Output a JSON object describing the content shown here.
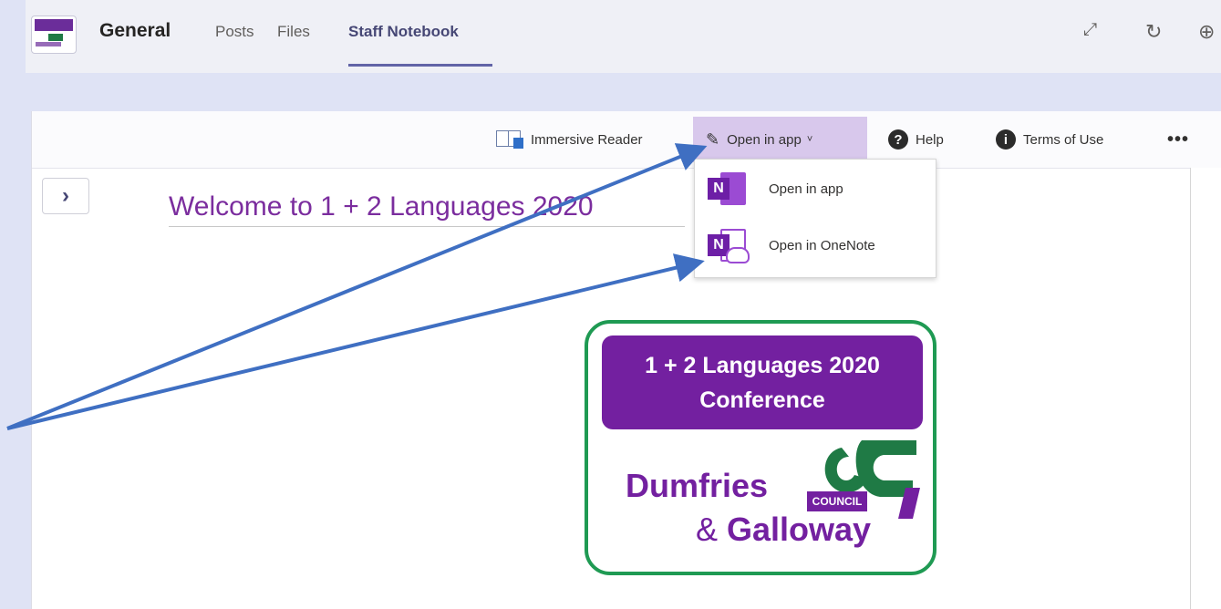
{
  "header": {
    "channel": "General",
    "tabs": [
      {
        "label": "Posts"
      },
      {
        "label": "Files"
      },
      {
        "label": "Staff Notebook",
        "active": true
      }
    ],
    "icons": [
      "expand-icon",
      "refresh-icon",
      "globe-icon"
    ]
  },
  "toolbar": {
    "immersive_reader": "Immersive Reader",
    "open_in_app": "Open in app",
    "open_caret": "˅",
    "help": "Help",
    "terms": "Terms of Use",
    "more": "•••"
  },
  "dropdown": {
    "items": [
      {
        "label": "Open in app",
        "icon": "onenote-app-icon"
      },
      {
        "label": "Open in OneNote",
        "icon": "onenote-web-icon"
      }
    ]
  },
  "page": {
    "title": "Welcome to 1 + 2 Languages 2020"
  },
  "logo": {
    "line1": "1 + 2 Languages 2020",
    "line2": "Conference",
    "org1": "Dumfries",
    "org2_prefix": "& ",
    "org2": "Galloway",
    "council": "COUNCIL"
  },
  "colors": {
    "accent": "#6264a7",
    "onenote_purple": "#7320a0",
    "arrow_blue": "#3f6fc2",
    "logo_green": "#1f9a53"
  }
}
